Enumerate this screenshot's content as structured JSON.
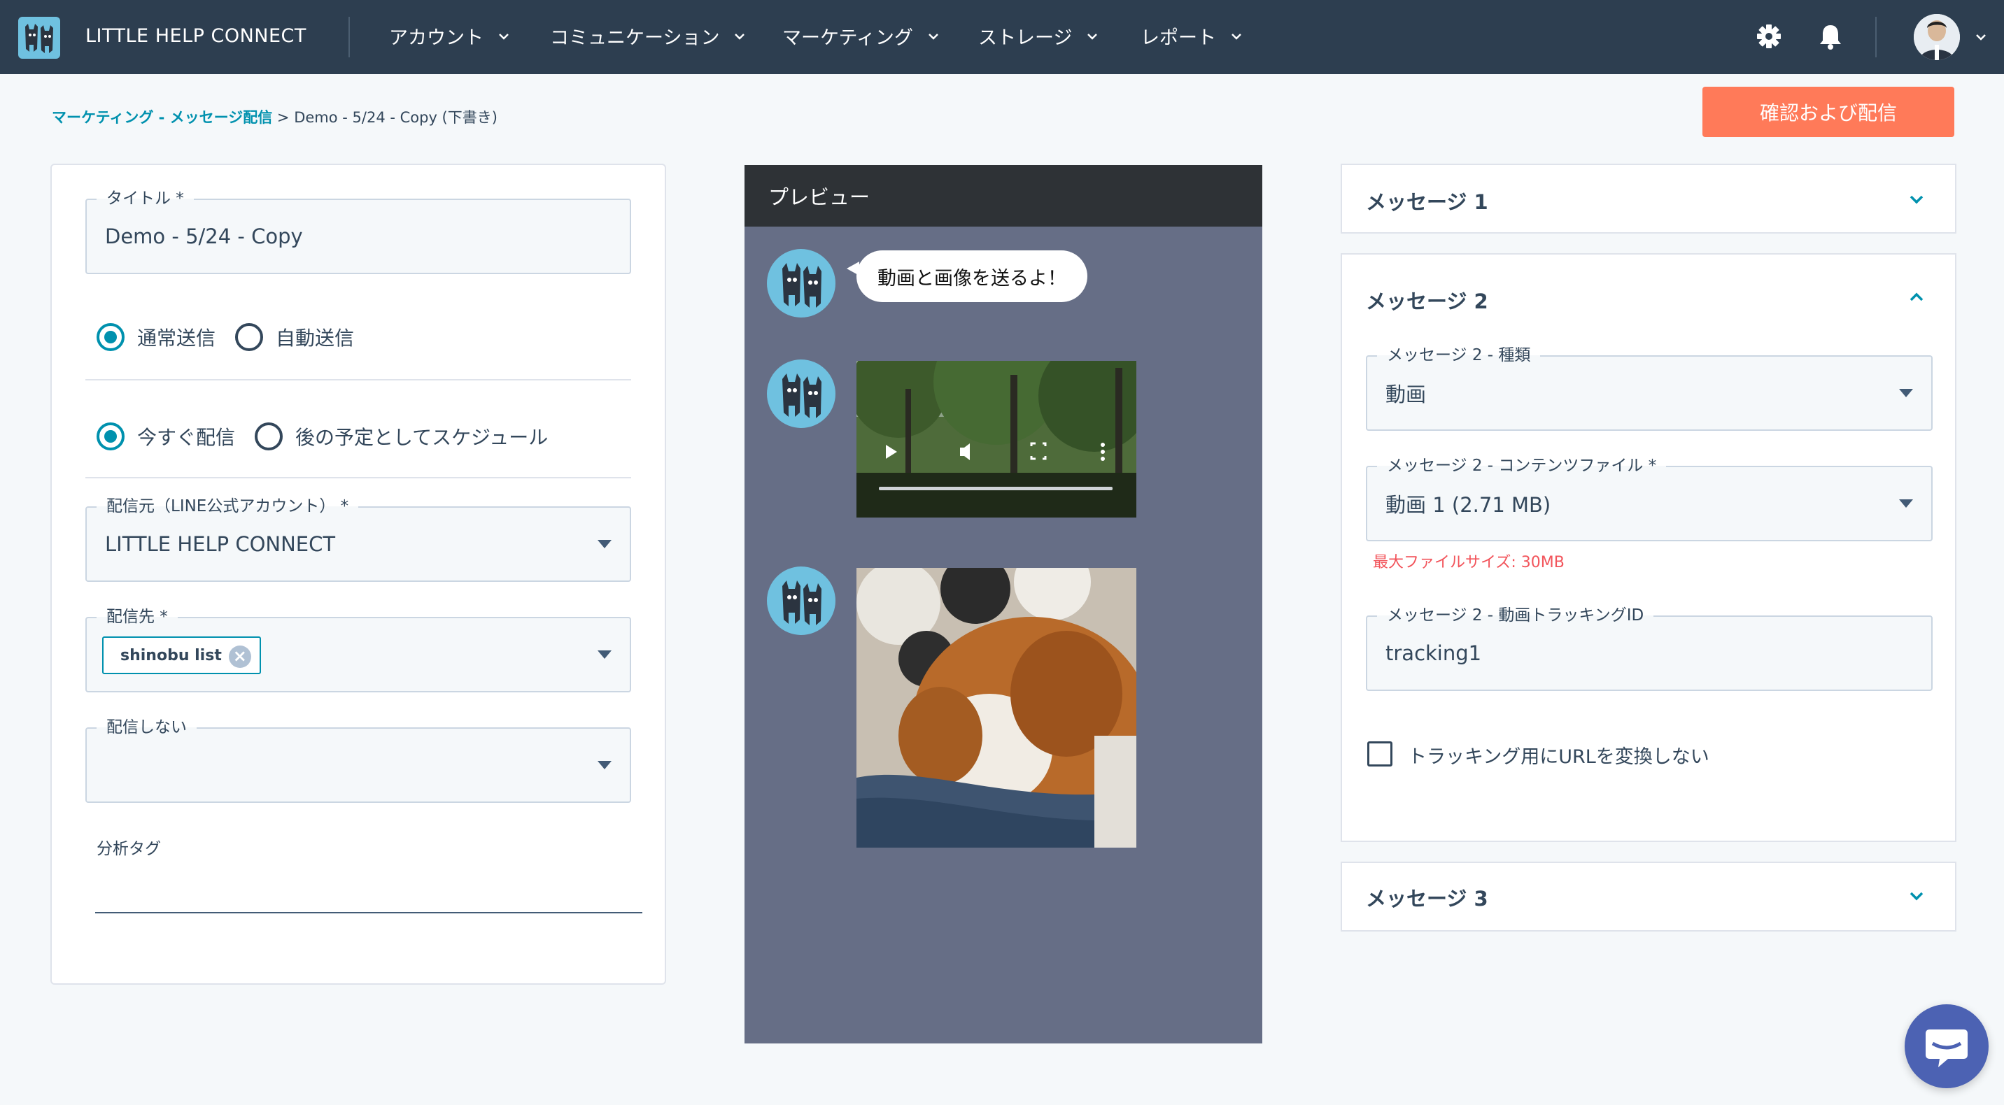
{
  "header": {
    "brand": "LITTLE HELP CONNECT",
    "nav": [
      {
        "label": "アカウント"
      },
      {
        "label": "コミュニケーション"
      },
      {
        "label": "マーケティング"
      },
      {
        "label": "ストレージ"
      },
      {
        "label": "レポート"
      }
    ],
    "icons": [
      "settings-icon",
      "bell-icon",
      "avatar"
    ]
  },
  "breadcrumb": {
    "link": "マーケティング - メッセージ配信",
    "sep": " > ",
    "current": "Demo - 5/24 - Copy (下書き)"
  },
  "primary_action": "確認および配信",
  "form": {
    "title_label": "タイトル *",
    "title_value": "Demo  - 5/24  - Copy",
    "send_mode": {
      "options": [
        "通常送信",
        "自動送信"
      ],
      "selected": "通常送信"
    },
    "timing": {
      "options": [
        "今すぐ配信",
        "後の予定としてスケジュール"
      ],
      "selected": "今すぐ配信"
    },
    "sender_label": "配信元（LINE公式アカウント） *",
    "sender_value": "LITTLE HELP CONNECT",
    "target_label": "配信先 *",
    "target_chip": "shinobu list",
    "exclude_label": "配信しない",
    "exclude_value": "",
    "tag_label": "分析タグ"
  },
  "preview": {
    "title": "プレビュー",
    "bubble_text": "動画と画像を送るよ！"
  },
  "messages": {
    "m1_title": "メッセージ 1",
    "m2_title": "メッセージ 2",
    "m2_type_label": "メッセージ 2 - 種類",
    "m2_type_value": "動画",
    "m2_file_label": "メッセージ 2 - コンテンツファイル *",
    "m2_file_value": "動画 1 (2.71 MB)",
    "m2_file_hint": "最大ファイルサイズ: 30MB",
    "m2_track_label": "メッセージ 2 - 動画トラッキングID",
    "m2_track_value": "tracking1",
    "m2_checkbox_label": "トラッキング用にURLを変換しない",
    "m3_title": "メッセージ 3"
  },
  "colors": {
    "header_bg": "#2d3e50",
    "accent": "#0091ae",
    "primary_button": "#ff7a59",
    "preview_bg": "#666e86",
    "error": "#f2545b"
  }
}
